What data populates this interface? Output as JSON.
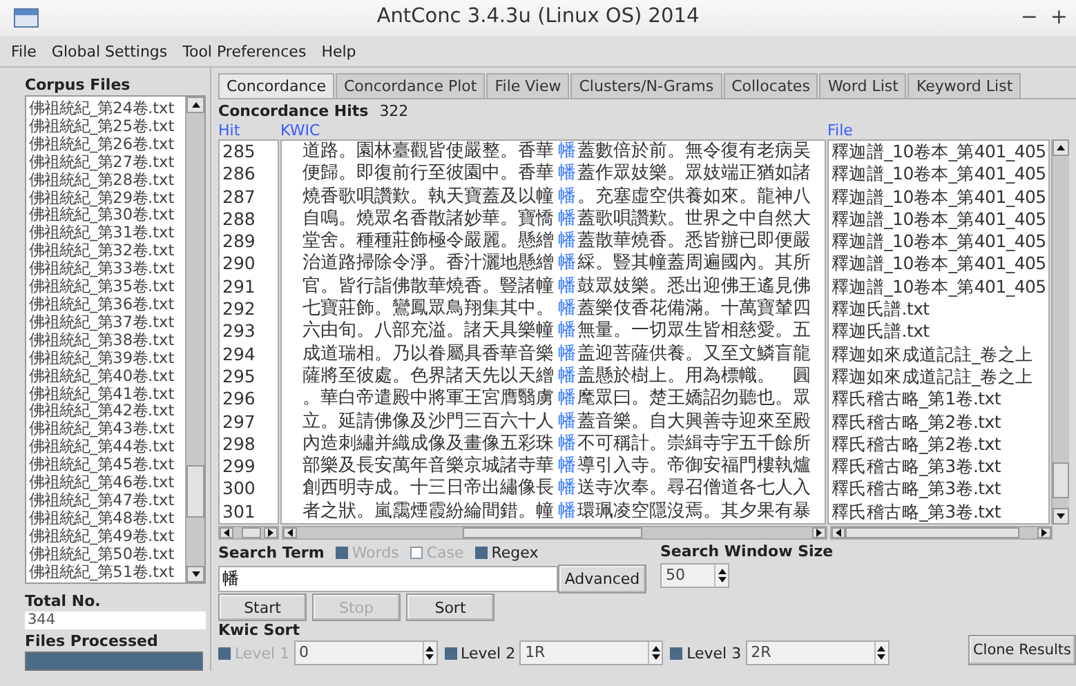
{
  "window": {
    "title": "AntConc 3.4.3u (Linux OS) 2014",
    "controls": [
      "−",
      "+"
    ]
  },
  "menu": [
    "File",
    "Global Settings",
    "Tool Preferences",
    "Help"
  ],
  "corpus_files": {
    "label": "Corpus Files",
    "items": [
      {
        "name": "佛祖統紀_第24卷.txt",
        "selected": false
      },
      {
        "name": "佛祖統紀_第25卷.txt",
        "selected": false
      },
      {
        "name": "佛祖統紀_第26卷.txt",
        "selected": false
      },
      {
        "name": "佛祖統紀_第27卷.txt",
        "selected": false
      },
      {
        "name": "佛祖統紀_第28卷.txt",
        "selected": false
      },
      {
        "name": "佛祖統紀_第29卷.txt",
        "selected": false
      },
      {
        "name": "佛祖統紀_第30卷.txt",
        "selected": false
      },
      {
        "name": "佛祖統紀_第31卷.txt",
        "selected": false
      },
      {
        "name": "佛祖統紀_第32卷.txt",
        "selected": false
      },
      {
        "name": "佛祖統紀_第33卷.txt",
        "selected": false
      },
      {
        "name": "佛祖統紀_第35卷.txt",
        "selected": false
      },
      {
        "name": "佛祖統紀_第36卷.txt",
        "selected": false
      },
      {
        "name": "佛祖統紀_第37卷.txt",
        "selected": false
      },
      {
        "name": "佛祖統紀_第38卷.txt",
        "selected": false
      },
      {
        "name": "佛祖統紀_第39卷.txt",
        "selected": false
      },
      {
        "name": "佛祖統紀_第40卷.txt",
        "selected": false
      },
      {
        "name": "佛祖統紀_第41卷.txt",
        "selected": false
      },
      {
        "name": "佛祖統紀_第42卷.txt",
        "selected": false
      },
      {
        "name": "佛祖統紀_第43卷.txt",
        "selected": false
      },
      {
        "name": "佛祖統紀_第44卷.txt",
        "selected": false
      },
      {
        "name": "佛祖統紀_第45卷.txt",
        "selected": false
      },
      {
        "name": "佛祖統紀_第46卷.txt",
        "selected": false
      },
      {
        "name": "佛祖統紀_第47卷.txt",
        "selected": false
      },
      {
        "name": "佛祖統紀_第48卷.txt",
        "selected": false
      },
      {
        "name": "佛祖統紀_第49卷.txt",
        "selected": false
      },
      {
        "name": "佛祖統紀_第50卷.txt",
        "selected": false
      },
      {
        "name": "佛祖統紀_第51卷.txt",
        "selected": false
      }
    ]
  },
  "total_no": {
    "label": "Total No.",
    "value": "344"
  },
  "files_processed": {
    "label": "Files Processed",
    "level": 1
  },
  "tabs": [
    {
      "label": "Concordance",
      "selected": true
    },
    {
      "label": "Concordance Plot",
      "selected": false
    },
    {
      "label": "File View",
      "selected": false
    },
    {
      "label": "Clusters/N-Grams",
      "selected": false
    },
    {
      "label": "Collocates",
      "selected": false
    },
    {
      "label": "Word List",
      "selected": false
    },
    {
      "label": "Keyword List",
      "selected": false
    }
  ],
  "concordance_hits": {
    "label": "Concordance Hits",
    "value": "322"
  },
  "table": {
    "columns": [
      "Hit",
      "KWIC",
      "File"
    ],
    "rows": [
      {
        "hit": "285",
        "left": "道路。園林臺觀皆使嚴整。香華",
        "keyword": "幡",
        "right": "蓋數倍於前。無令復有老病吴",
        "file": "釋迦譜_10卷本_第401_405"
      },
      {
        "hit": "286",
        "left": "便歸。即復前行至彼園中。香華",
        "keyword": "幡",
        "right": "蓋作眾妓樂。眾妓端正猶如諸",
        "file": "釋迦譜_10卷本_第401_405"
      },
      {
        "hit": "287",
        "left": "燒香歌唄讚歎。執天寶蓋及以幢",
        "keyword": "幡",
        "right": "。充塞虛空供養如來。龍神八",
        "file": "釋迦譜_10卷本_第401_405"
      },
      {
        "hit": "288",
        "left": "自鳴。燒眾名香散諸妙華。寶憍",
        "keyword": "幡",
        "right": "蓋歌唄讚歎。世界之中自然大",
        "file": "釋迦譜_10卷本_第401_405"
      },
      {
        "hit": "289",
        "left": "堂舍。種種莊飾極令嚴麗。懸繒",
        "keyword": "幡",
        "right": "蓋散華燒香。悉皆辦已即便嚴",
        "file": "釋迦譜_10卷本_第401_405"
      },
      {
        "hit": "290",
        "left": "治道路掃除令淨。香汁灑地懸繒",
        "keyword": "幡",
        "right": "綵。豎其幢蓋周遍國內。其所",
        "file": "釋迦譜_10卷本_第401_405"
      },
      {
        "hit": "291",
        "left": "官。皆行詣佛散華燒香。豎諸幢",
        "keyword": "幡",
        "right": "鼓眾妓樂。悉出迎佛王遙見佛",
        "file": "釋迦譜_10卷本_第401_405"
      },
      {
        "hit": "292",
        "left": "七寶莊飾。鸞鳳眾鳥翔集其中。",
        "keyword": "幡",
        "right": "蓋樂伎香花備滿。十萬寶輦四",
        "file": "釋迦氏譜.txt"
      },
      {
        "hit": "293",
        "left": "六由旬。八部充溢。諸天具樂幢",
        "keyword": "幡",
        "right": "無量。一切眾生皆相慈愛。五",
        "file": "釋迦氏譜.txt"
      },
      {
        "hit": "294",
        "left": "成道瑞相。乃以眷屬具香華音樂",
        "keyword": "幡",
        "right": "盖迎菩薩供養。又至文鱗盲龍",
        "file": "釋迦如來成道記註_卷之上"
      },
      {
        "hit": "295",
        "left": "薩將至彼處。色界諸天先以天繒",
        "keyword": "幡",
        "right": "盖懸於樹上。用為標幟。　圓",
        "file": "釋迦如來成道記註_卷之上"
      },
      {
        "hit": "296",
        "left": "。華白帝遣殿中將軍王宮膺翳虜",
        "keyword": "幡",
        "right": "麾眾曰。楚王嬌詔勿聽也。眾",
        "file": "釋氏稽古略_第1卷.txt"
      },
      {
        "hit": "297",
        "left": "立。延請佛像及沙門三百六十人",
        "keyword": "幡",
        "right": "蓋音樂。自大興善寺迎來至殿",
        "file": "釋氏稽古略_第2卷.txt"
      },
      {
        "hit": "298",
        "left": "內造刺繡并織成像及畫像五彩珠",
        "keyword": "幡",
        "right": "不可稱計。崇緝寺宇五千餘所",
        "file": "釋氏稽古略_第2卷.txt"
      },
      {
        "hit": "299",
        "left": "部樂及長安萬年音樂京城諸寺華",
        "keyword": "幡",
        "right": "導引入寺。帝御安福門樓執爐",
        "file": "釋氏稽古略_第3卷.txt"
      },
      {
        "hit": "300",
        "left": "創西明寺成。十三日帝出繡像長",
        "keyword": "幡",
        "right": "送寺次奉。尋召僧道各七人入",
        "file": "釋氏稽古略_第3卷.txt"
      },
      {
        "hit": "301",
        "left": "者之狀。嵐靄煙霞紛綸間錯。幢",
        "keyword": "幡",
        "right": "環珮凌空隱沒焉。其夕果有暴",
        "file": "釋氏稽古略_第3卷.txt"
      }
    ]
  },
  "search": {
    "label": "Search Term",
    "options": [
      {
        "label": "Words",
        "checked": true,
        "disabled": true
      },
      {
        "label": "Case",
        "checked": false,
        "disabled": true
      },
      {
        "label": "Regex",
        "checked": true,
        "disabled": false
      }
    ],
    "value": "幡",
    "advanced_button": "Advanced"
  },
  "search_window_size": {
    "label": "Search Window Size",
    "value": "50"
  },
  "buttons": [
    {
      "label": "Start",
      "disabled": false
    },
    {
      "label": "Stop",
      "disabled": true
    },
    {
      "label": "Sort",
      "disabled": false
    }
  ],
  "kwic_sort": {
    "label": "Kwic Sort",
    "levels": [
      {
        "label": "Level 1",
        "checked": true,
        "disabled": true,
        "value": "0"
      },
      {
        "label": "Level 2",
        "checked": true,
        "disabled": false,
        "value": "1R"
      },
      {
        "label": "Level 3",
        "checked": true,
        "disabled": false,
        "value": "2R"
      }
    ]
  },
  "clone_button": "Clone Results"
}
